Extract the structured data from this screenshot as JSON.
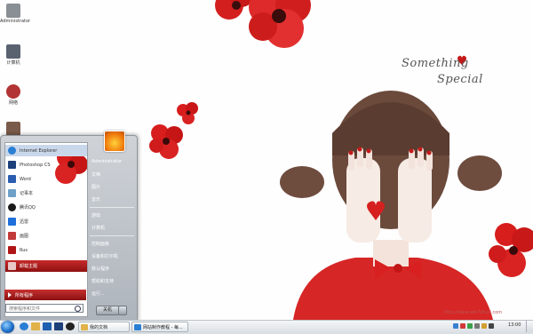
{
  "wallpaper": {
    "line1": "Something",
    "line2": "Special",
    "watermark": "http://www.win7zhuti.com"
  },
  "desktop_icons": [
    {
      "label": "Administrator",
      "icon": "user-folder-icon",
      "color": "#8a8f96"
    },
    {
      "label": "计算机",
      "icon": "computer-icon",
      "color": "#5a6270"
    },
    {
      "label": "网络",
      "icon": "network-icon",
      "color": "#b33434"
    },
    {
      "label": "",
      "icon": "recycle-bin-icon",
      "color": "#7a5a4a"
    }
  ],
  "start_menu": {
    "pinned": [
      {
        "label": "Internet Explorer",
        "icon": "ie-icon",
        "color": "#2a7fd4"
      },
      {
        "label": "Photoshop CS",
        "icon": "photoshop-icon",
        "color": "#1d3f7a"
      },
      {
        "label": "Word",
        "icon": "word-icon",
        "color": "#2a5db0"
      },
      {
        "label": "记事本",
        "icon": "notepad-icon",
        "color": "#6fa0c8"
      },
      {
        "label": "腾讯QQ",
        "icon": "qq-icon",
        "color": "#1a1a1a"
      },
      {
        "label": "迅雷",
        "icon": "thunder-icon",
        "color": "#1e6fd9"
      },
      {
        "label": "画图",
        "icon": "paint-icon",
        "color": "#c23a3a"
      },
      {
        "label": "Rus",
        "icon": "rus-icon",
        "color": "#b01515"
      },
      {
        "label": "卸载主题",
        "icon": "uninstall-icon",
        "color": "#e9c7c7"
      }
    ],
    "all_programs": "所有程序",
    "search_placeholder": "搜索程序和文件",
    "right_items": [
      "Administrator",
      "文档",
      "图片",
      "音乐",
      "游戏",
      "计算机",
      "控制面板",
      "设备和打印机",
      "默认程序",
      "帮助和支持",
      "运行..."
    ],
    "shutdown_label": "关机"
  },
  "taskbar": {
    "quick_launch": [
      {
        "icon": "ie-icon",
        "color": "#2a7fd4"
      },
      {
        "icon": "folder-icon",
        "color": "#e1b24a"
      },
      {
        "icon": "media-player-icon",
        "color": "#1f5fb0"
      },
      {
        "icon": "photoshop-icon",
        "color": "#1d3f7a"
      },
      {
        "icon": "qq-icon",
        "color": "#222222"
      },
      {
        "icon": "thunder-icon",
        "color": "#2a6fd0"
      }
    ],
    "buttons": [
      {
        "label": "我的文档",
        "icon": "folder-icon",
        "color": "#e1b24a"
      },
      {
        "label": "网站制作教程 - 每...",
        "icon": "ie-icon",
        "color": "#2a7fd4"
      }
    ],
    "clock": "13:00"
  },
  "colors": {
    "accent": "#b01818",
    "petal": "#d41f1f"
  }
}
